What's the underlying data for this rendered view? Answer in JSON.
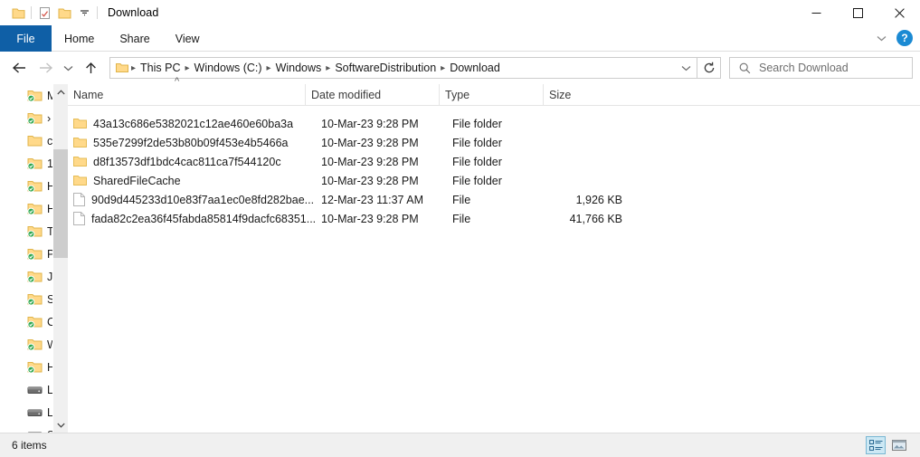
{
  "window": {
    "title": "Download",
    "quick_access": [
      {
        "name": "folder-icon",
        "label": "Folder"
      },
      {
        "name": "properties-icon",
        "label": "Properties"
      },
      {
        "name": "new-folder-icon",
        "label": "New folder"
      },
      {
        "name": "chevron-down-icon",
        "label": "Customize Quick Access Toolbar"
      }
    ],
    "controls": [
      {
        "name": "minimize-button",
        "glyph": "—"
      },
      {
        "name": "maximize-button",
        "glyph": "□"
      },
      {
        "name": "close-button",
        "glyph": "✕"
      }
    ]
  },
  "ribbon": {
    "tabs": [
      {
        "label": "File",
        "active": true
      },
      {
        "label": "Home",
        "active": false
      },
      {
        "label": "Share",
        "active": false
      },
      {
        "label": "View",
        "active": false
      }
    ],
    "expand_label": "Expand the Ribbon",
    "help_label": "?"
  },
  "address": {
    "back_label": "Back",
    "forward_label": "Forward",
    "recent_label": "Recent locations",
    "up_label": "Up one level",
    "refresh_label": "Refresh",
    "dropdown_label": "Previous Locations",
    "breadcrumbs": [
      "This PC",
      "Windows (C:)",
      "Windows",
      "SoftwareDistribution",
      "Download"
    ]
  },
  "search": {
    "placeholder": "Search Download",
    "value": "",
    "icon": "search-icon"
  },
  "navpane": {
    "items": [
      {
        "label": "M",
        "icon": "folder-synced-icon"
      },
      {
        "label": "›",
        "icon": "folder-synced-icon"
      },
      {
        "label": "c",
        "icon": "folder-icon"
      },
      {
        "label": "1",
        "icon": "folder-synced-icon"
      },
      {
        "label": "H",
        "icon": "folder-synced-icon"
      },
      {
        "label": "H",
        "icon": "folder-synced-icon"
      },
      {
        "label": "T",
        "icon": "folder-synced-icon"
      },
      {
        "label": "P",
        "icon": "folder-synced-icon"
      },
      {
        "label": "J",
        "icon": "folder-synced-icon"
      },
      {
        "label": "S",
        "icon": "folder-synced-icon"
      },
      {
        "label": "C",
        "icon": "folder-synced-icon"
      },
      {
        "label": "W",
        "icon": "folder-synced-icon"
      },
      {
        "label": "H",
        "icon": "folder-synced-icon"
      },
      {
        "label": "L",
        "icon": "drive-icon"
      },
      {
        "label": "L",
        "icon": "drive-icon"
      },
      {
        "label": "S",
        "icon": "drive-icon"
      }
    ],
    "scroll_up_label": "Scroll up",
    "scroll_down_label": "Scroll down"
  },
  "filelist": {
    "columns": [
      {
        "key": "name",
        "label": "Name",
        "sorted": "asc"
      },
      {
        "key": "date",
        "label": "Date modified",
        "sorted": ""
      },
      {
        "key": "type",
        "label": "Type",
        "sorted": ""
      },
      {
        "key": "size",
        "label": "Size",
        "sorted": ""
      }
    ],
    "rows": [
      {
        "name": "43a13c686e5382021c12ae460e60ba3a",
        "date": "10-Mar-23 9:28 PM",
        "type": "File folder",
        "size": "",
        "icon": "folder-icon"
      },
      {
        "name": "535e7299f2de53b80b09f453e4b5466a",
        "date": "10-Mar-23 9:28 PM",
        "type": "File folder",
        "size": "",
        "icon": "folder-icon"
      },
      {
        "name": "d8f13573df1bdc4cac811ca7f544120c",
        "date": "10-Mar-23 9:28 PM",
        "type": "File folder",
        "size": "",
        "icon": "folder-icon"
      },
      {
        "name": "SharedFileCache",
        "date": "10-Mar-23 9:28 PM",
        "type": "File folder",
        "size": "",
        "icon": "folder-icon"
      },
      {
        "name": "90d9d445233d10e83f7aa1ec0e8fd282bae...",
        "date": "12-Mar-23 11:37 AM",
        "type": "File",
        "size": "1,926 KB",
        "icon": "file-icon"
      },
      {
        "name": "fada82c2ea36f45fabda85814f9dacfc68351...",
        "date": "10-Mar-23 9:28 PM",
        "type": "File",
        "size": "41,766 KB",
        "icon": "file-icon"
      }
    ]
  },
  "statusbar": {
    "item_count": "6 items",
    "views": [
      {
        "name": "details-view-button",
        "label": "Details",
        "active": true
      },
      {
        "name": "large-icons-view-button",
        "label": "Large icons",
        "active": false
      }
    ]
  },
  "colors": {
    "accent": "#0f5fa6",
    "folder": "#ffd98a",
    "folder_edge": "#e8b94a",
    "selection": "#cce8f4",
    "help_blue": "#1b8ad3"
  }
}
